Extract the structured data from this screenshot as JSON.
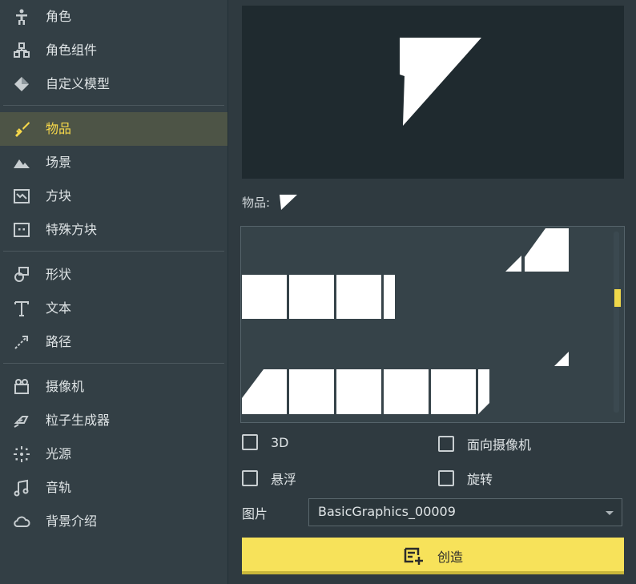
{
  "sidebar": {
    "items": [
      {
        "label": "角色",
        "icon": "character-icon"
      },
      {
        "label": "角色组件",
        "icon": "character-parts-icon"
      },
      {
        "label": "自定义模型",
        "icon": "custom-model-icon"
      },
      {
        "label": "物品",
        "icon": "sword-icon",
        "active": true
      },
      {
        "label": "场景",
        "icon": "mountain-icon"
      },
      {
        "label": "方块",
        "icon": "block-icon"
      },
      {
        "label": "特殊方块",
        "icon": "special-block-icon"
      },
      {
        "label": "形状",
        "icon": "shapes-icon"
      },
      {
        "label": "文本",
        "icon": "text-icon"
      },
      {
        "label": "路径",
        "icon": "path-icon"
      },
      {
        "label": "摄像机",
        "icon": "camera-icon"
      },
      {
        "label": "粒子生成器",
        "icon": "particle-icon"
      },
      {
        "label": "光源",
        "icon": "light-icon"
      },
      {
        "label": "音轨",
        "icon": "music-icon"
      },
      {
        "label": "背景介绍",
        "icon": "cloud-icon"
      }
    ]
  },
  "main": {
    "item_label": "物品:",
    "checkboxes": {
      "three_d": {
        "label": "3D",
        "checked": false
      },
      "face_camera": {
        "label": "面向摄像机",
        "checked": false
      },
      "floating": {
        "label": "悬浮",
        "checked": false
      },
      "rotate": {
        "label": "旋转",
        "checked": false
      }
    },
    "image_label": "图片",
    "image_value": "BasicGraphics_00009",
    "create_label": "创造"
  },
  "colors": {
    "accent": "#f7e25a",
    "active_text": "#f7d84a",
    "sidebar_bg": "#333f45",
    "preview_bg": "#1f2a2f"
  }
}
